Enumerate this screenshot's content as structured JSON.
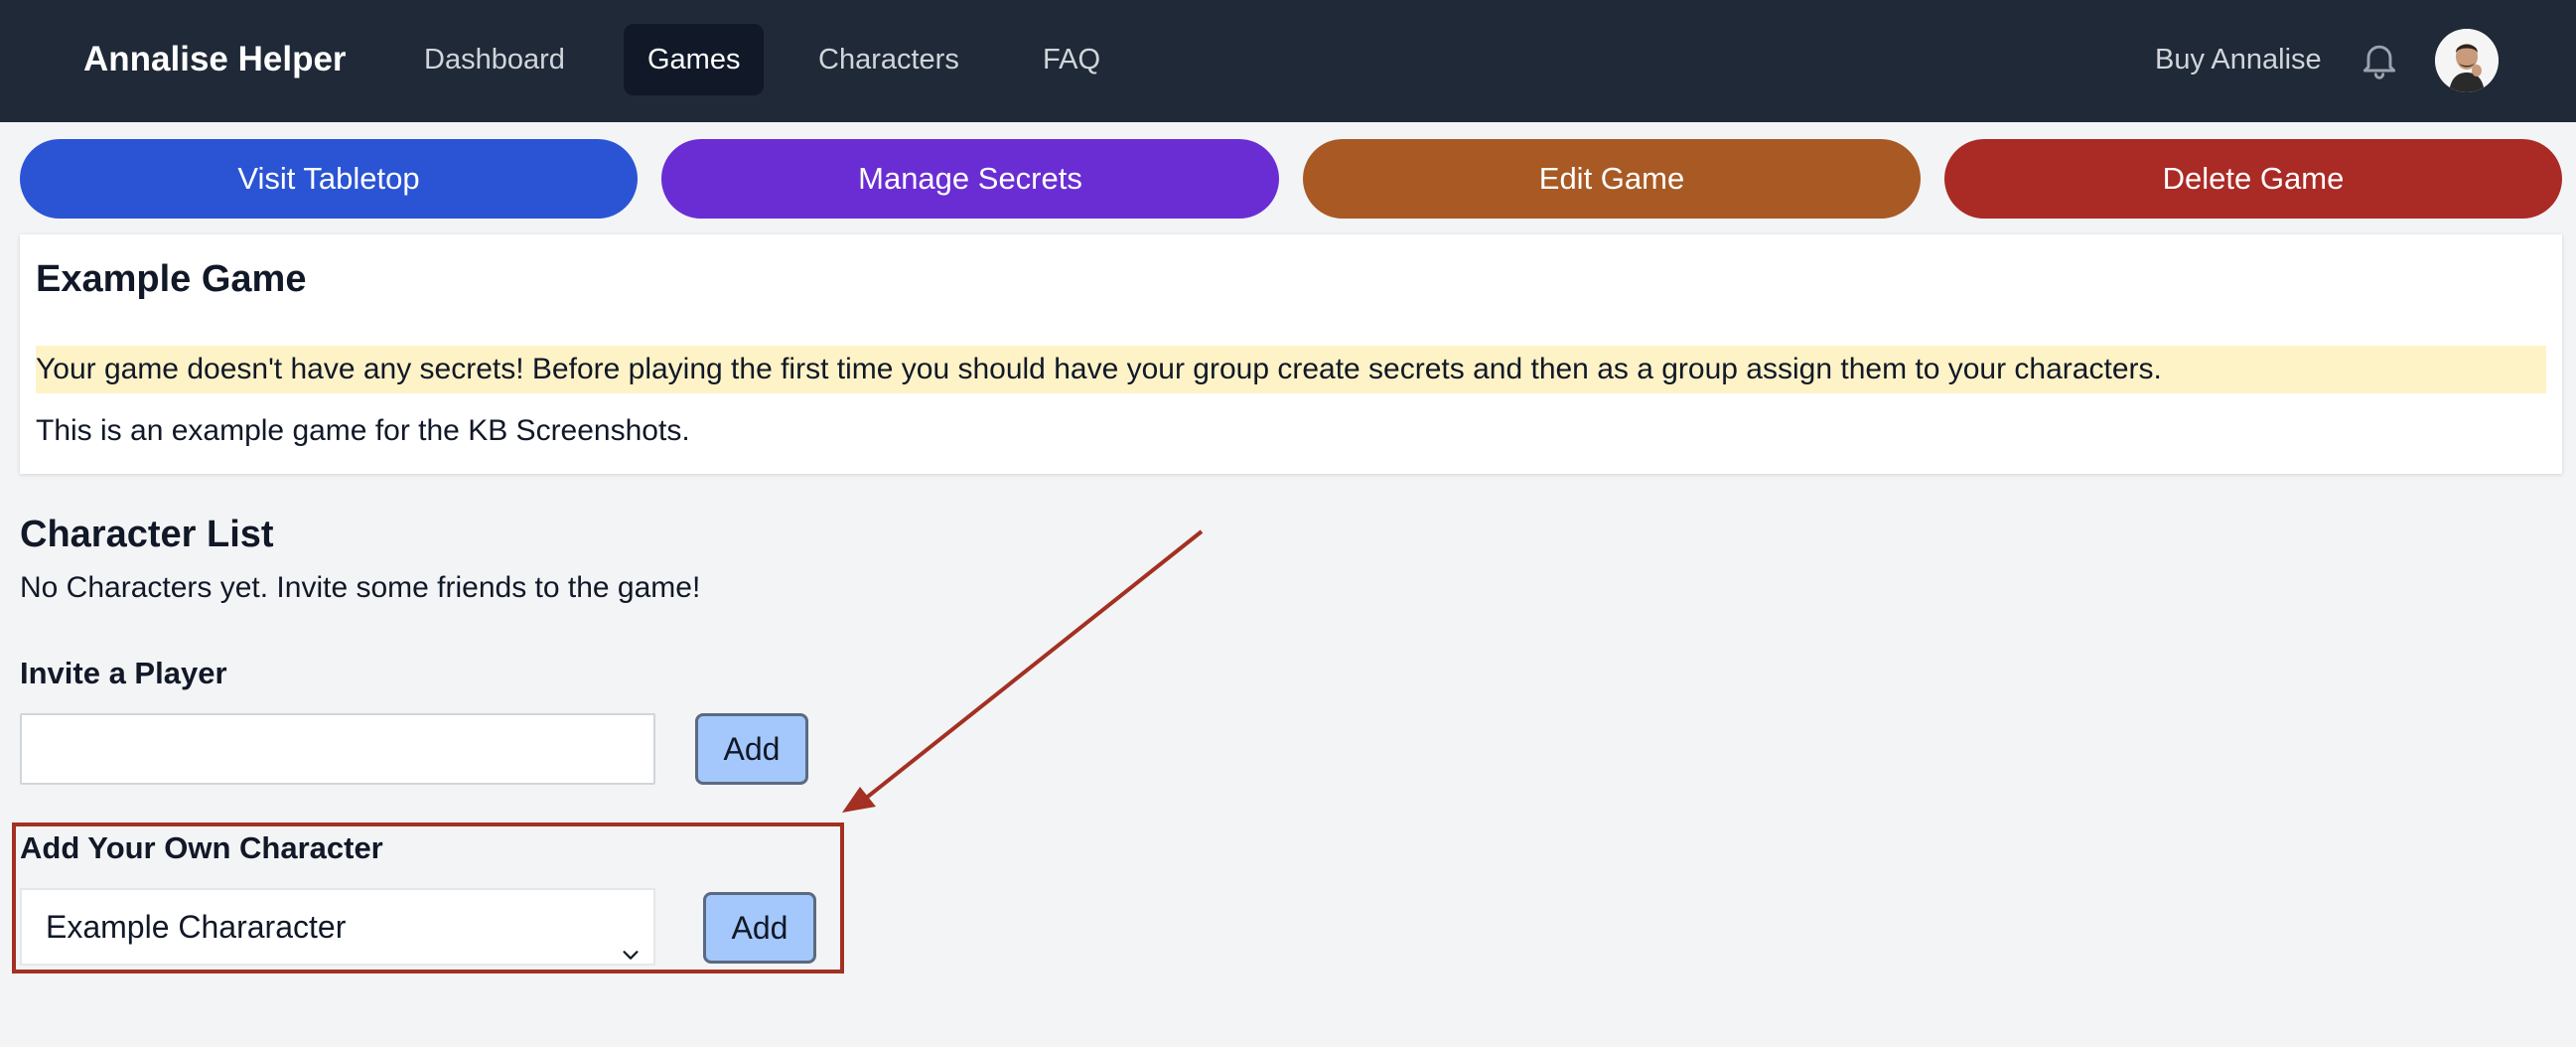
{
  "navbar": {
    "brand": "Annalise Helper",
    "links": [
      {
        "label": "Dashboard",
        "active": false
      },
      {
        "label": "Games",
        "active": true
      },
      {
        "label": "Characters",
        "active": false
      },
      {
        "label": "FAQ",
        "active": false
      }
    ],
    "buy_label": "Buy Annalise",
    "bell_icon": "bell-icon",
    "avatar_icon": "user-avatar"
  },
  "actions": {
    "visit_label": "Visit Tabletop",
    "secrets_label": "Manage Secrets",
    "edit_label": "Edit Game",
    "delete_label": "Delete Game"
  },
  "game": {
    "title": "Example Game",
    "warning": "Your game doesn't have any secrets! Before playing the first time you should have your group create secrets and then as a group assign them to your characters.",
    "description": "This is an example game for the KB Screenshots."
  },
  "characters": {
    "title": "Character List",
    "empty_message": "No Characters yet. Invite some friends to the game!"
  },
  "invite": {
    "label": "Invite a Player",
    "value": "",
    "add_label": "Add"
  },
  "own_character": {
    "label": "Add Your Own Character",
    "selected": "Example Chararacter",
    "add_label": "Add"
  },
  "colors": {
    "navbar": "#1f2937",
    "visit": "#2b54d4",
    "secrets": "#6a2dd4",
    "edit": "#a85924",
    "delete": "#aa2a25",
    "warning_bg": "#fef3c7",
    "annotation": "#a33022"
  }
}
